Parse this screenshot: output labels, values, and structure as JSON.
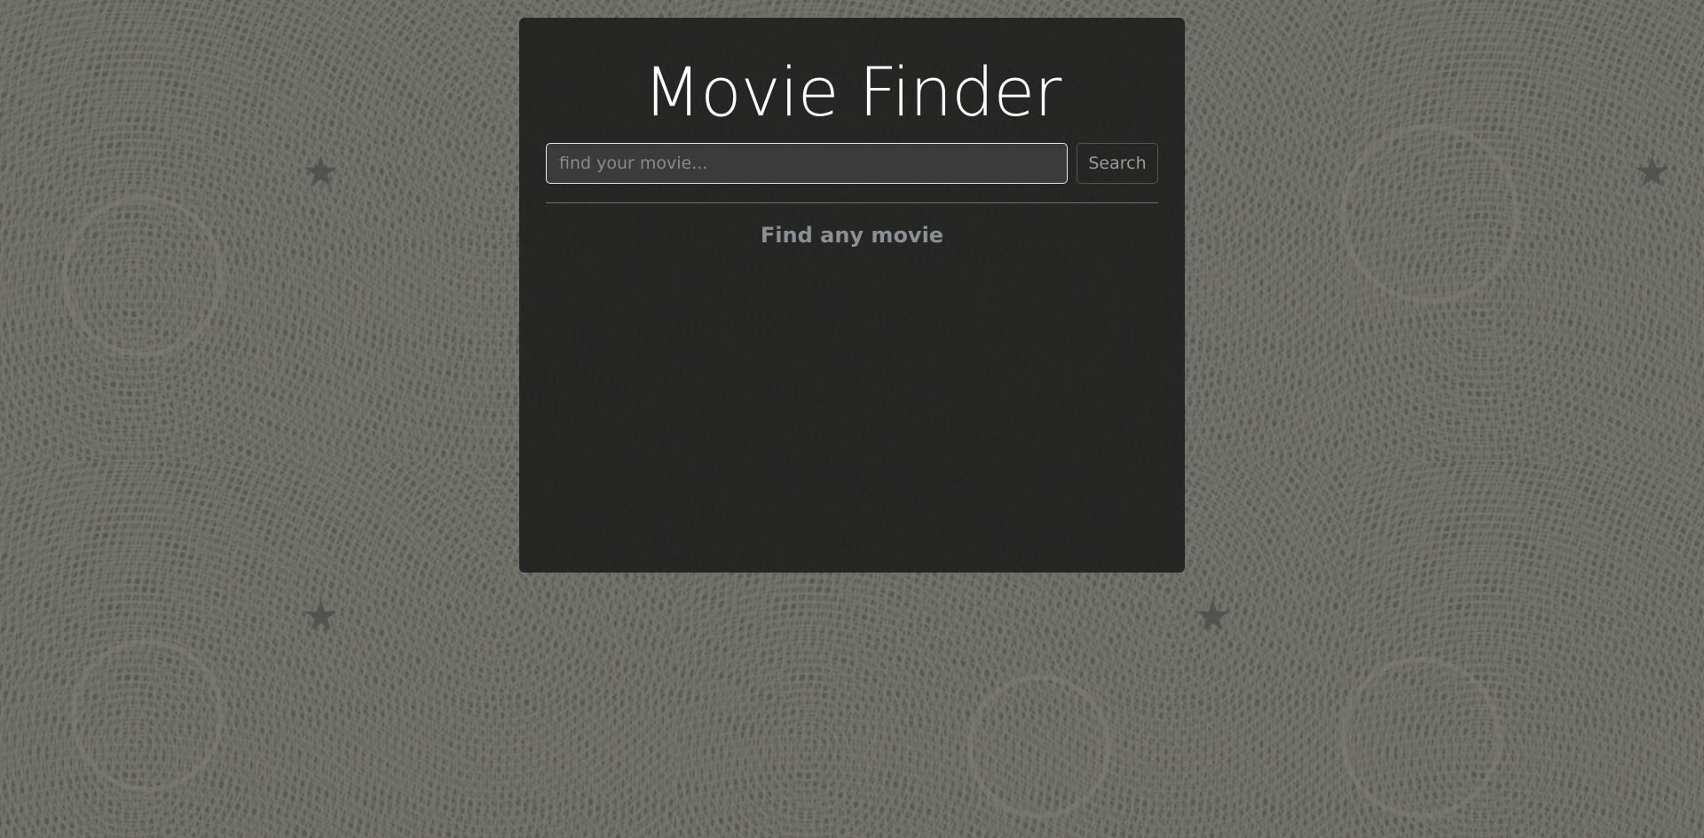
{
  "app": {
    "title": "Movie Finder"
  },
  "search": {
    "placeholder": "find your movie...",
    "value": "",
    "button_label": "Search"
  },
  "results": {
    "empty_message": "Find any movie"
  },
  "colors": {
    "background": "#5a5a57",
    "card": "#1e1e1e",
    "title_text": "#ffffff",
    "subtitle_text": "#8a9095"
  }
}
